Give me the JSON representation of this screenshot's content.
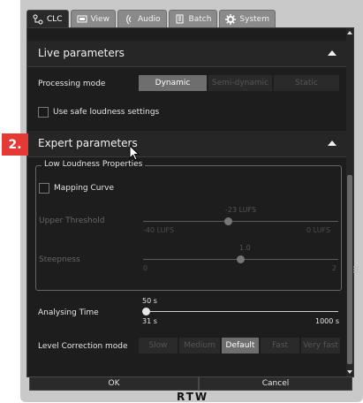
{
  "tabs": [
    {
      "label": "CLC",
      "icon": "clc-icon",
      "active": true
    },
    {
      "label": "View",
      "icon": "monitor-icon"
    },
    {
      "label": "Audio",
      "icon": "audio-icon"
    },
    {
      "label": "Batch",
      "icon": "batch-icon"
    },
    {
      "label": "System",
      "icon": "gear-icon"
    }
  ],
  "live": {
    "title": "Live parameters",
    "processing_mode_label": "Processing mode",
    "modes": [
      "Dynamic",
      "Semi-dynamic",
      "Static"
    ],
    "selected_mode": "Dynamic",
    "safe_loudness_label": "Use safe loudness settings",
    "safe_loudness_checked": false
  },
  "expert": {
    "title": "Expert parameters",
    "badge": "2.",
    "fieldset_label": "Low Loudness Properties",
    "mapping_curve_label": "Mapping Curve",
    "mapping_curve_checked": false,
    "upper_threshold": {
      "label": "Upper Threshold",
      "value": "-23 LUFS",
      "min": "-40 LUFS",
      "max": "0 LUFS",
      "position": 0.43
    },
    "steepness": {
      "label": "Steepness",
      "value": "1.0",
      "min": "0",
      "max": "2",
      "position": 0.5
    },
    "analysing_time": {
      "label": "Analysing Time",
      "value": "50 s",
      "min": "31 s",
      "max": "1000 s",
      "position": 0.02
    },
    "level_correction": {
      "label": "Level Correction mode",
      "options": [
        "Slow",
        "Medium",
        "Default",
        "Fast",
        "Very fast"
      ],
      "selected": "Default"
    }
  },
  "footer": {
    "ok_label": "OK",
    "cancel_label": "Cancel"
  },
  "brand": {
    "logo_text": "RTW"
  },
  "colors": {
    "accent": "#e53935",
    "panel_bg": "#1d1d1d",
    "selected_bg": "#5c5c5c"
  }
}
